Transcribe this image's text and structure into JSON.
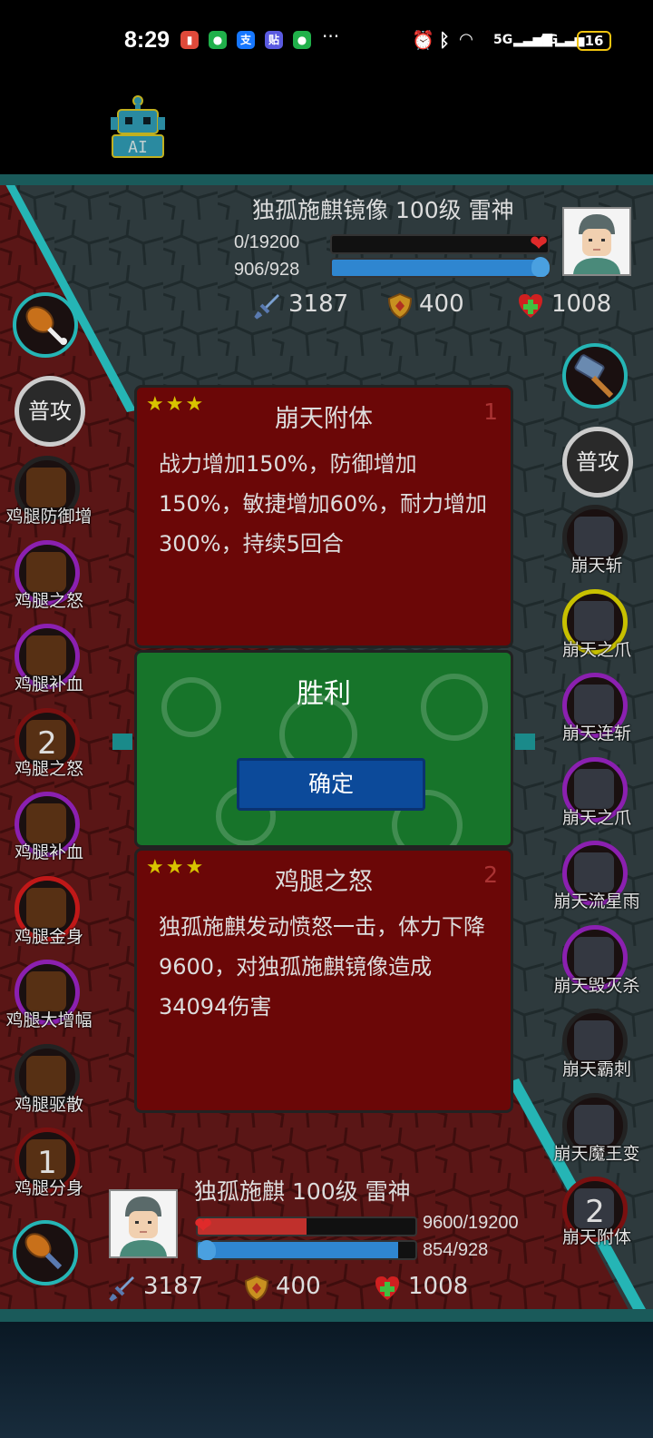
{
  "statusbar": {
    "time": "8:29",
    "icons": [
      "notification-icon",
      "wechat-icon",
      "alipay-icon",
      "tieba-icon",
      "wechat-icon"
    ],
    "more": "···",
    "signal_5g": "5G",
    "signal_4g": "4G",
    "battery": "16"
  },
  "ai_button": {
    "label": "AI"
  },
  "enemy": {
    "name": "独孤施麒镜像 100级 雷神",
    "hp_text": "0/19200",
    "hp_fraction": 0,
    "mp_text": "906/928",
    "mp_fraction": 0.976,
    "attack": "3187",
    "defense": "400",
    "health": "1008"
  },
  "player": {
    "name": "独孤施麒 100级 雷神",
    "hp_text": "9600/19200",
    "hp_fraction": 0.5,
    "mp_text": "854/928",
    "mp_fraction": 0.92,
    "attack": "3187",
    "defense": "400",
    "health": "1008"
  },
  "left_skills": {
    "normal_attack": "普攻",
    "items": [
      {
        "label": "鸡腿防御增",
        "count": "",
        "ring": "#222222"
      },
      {
        "label": "鸡腿之怒",
        "count": "",
        "ring": "#8b20b0"
      },
      {
        "label": "鸡腿补血",
        "count": "",
        "ring": "#8b20b0"
      },
      {
        "label": "鸡腿之怒",
        "count": "2",
        "ring": "#7a1010"
      },
      {
        "label": "鸡腿补血",
        "count": "",
        "ring": "#8b20b0"
      },
      {
        "label": "鸡腿金身",
        "count": "",
        "ring": "#c01818"
      },
      {
        "label": "鸡腿大增幅",
        "count": "",
        "ring": "#8b20b0"
      },
      {
        "label": "鸡腿驱散",
        "count": "",
        "ring": "#222222"
      },
      {
        "label": "鸡腿分身",
        "count": "1",
        "ring": "#7a1010"
      }
    ]
  },
  "right_skills": {
    "normal_attack": "普攻",
    "items": [
      {
        "label": "崩天斩",
        "count": "",
        "ring": "#222222"
      },
      {
        "label": "崩天之爪",
        "count": "",
        "ring": "#c8c000"
      },
      {
        "label": "崩天连斩",
        "count": "",
        "ring": "#8b20b0"
      },
      {
        "label": "崩天之爪",
        "count": "",
        "ring": "#8b20b0"
      },
      {
        "label": "崩天流星雨",
        "count": "",
        "ring": "#8b20b0"
      },
      {
        "label": "崩天毁灭杀",
        "count": "",
        "ring": "#8b20b0"
      },
      {
        "label": "崩天霸刺",
        "count": "",
        "ring": "#222222"
      },
      {
        "label": "崩天魔王变",
        "count": "",
        "ring": "#222222"
      },
      {
        "label": "崩天附体",
        "count": "2",
        "ring": "#7a1010"
      }
    ]
  },
  "card1": {
    "stars": "★★★",
    "title": "崩天附体",
    "number": "1",
    "description": "战力增加150%，防御增加150%，敏捷增加60%，耐力增加300%，持续5回合"
  },
  "result": {
    "title": "胜利",
    "confirm": "确定"
  },
  "card2": {
    "stars": "★★★",
    "title": "鸡腿之怒",
    "number": "2",
    "description": "独孤施麒发动愤怒一击，体力下降9600，对独孤施麒镜像造成34094伤害"
  }
}
